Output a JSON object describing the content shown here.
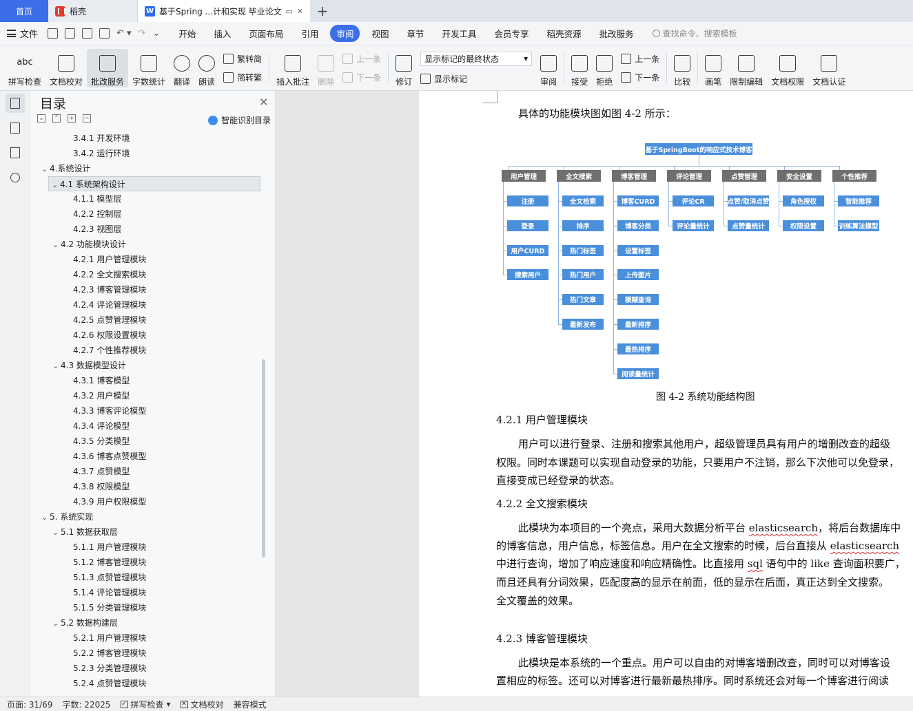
{
  "tabs": {
    "home": "首页",
    "daoke": "稻壳",
    "doc": "基于Spring ...计和实现 毕业论文",
    "add": "+"
  },
  "menu": {
    "file": "文件",
    "items": [
      "开始",
      "插入",
      "页面布局",
      "引用",
      "审阅",
      "视图",
      "章节",
      "开发工具",
      "会员专享",
      "稻壳资源",
      "批改服务"
    ],
    "active": "审阅",
    "search": "查找命令、搜索模板"
  },
  "ribbon": {
    "spell": "拼写检查",
    "spell_icon_text": "abc",
    "doccheck": "文档校对",
    "review_service": "批改服务",
    "wordcount": "字数统计",
    "translate": "翻译",
    "read": "朗读",
    "to_trad": "繁转简",
    "to_simp": "简转繁",
    "insert_comment": "插入批注",
    "delete": "删除",
    "prev": "上一条",
    "next": "下一条",
    "revise": "修订",
    "markup_state": "显示标记的最终状态",
    "show_markup": "显示标记",
    "review": "审阅",
    "accept": "接受",
    "reject": "拒绝",
    "prev2": "上一条",
    "next2": "下一条",
    "compare": "比较",
    "pen": "画笔",
    "restrict": "限制编辑",
    "doc_perm": "文档权限",
    "doc_cert": "文档认证"
  },
  "toc": {
    "title": "目录",
    "close": "×",
    "tools": [
      "⌄",
      "⌃",
      "+",
      "−"
    ],
    "smart": "智能识别目录",
    "items": [
      {
        "text": "3.4.1  开发环境",
        "level": 3
      },
      {
        "text": "3.4.2  运行环境",
        "level": 3
      },
      {
        "text": "4.系统设计",
        "level": 1,
        "caret": "⌄"
      },
      {
        "text": "4.1  系统架构设计",
        "level": 2,
        "caret": "⌄",
        "selected": true
      },
      {
        "text": "4.1.1 模型层",
        "level": 3
      },
      {
        "text": "4.2.2 控制层",
        "level": 3
      },
      {
        "text": "4.2.3 视图层",
        "level": 3
      },
      {
        "text": "4.2  功能模块设计",
        "level": 2,
        "caret": "⌄"
      },
      {
        "text": "4.2.1 用户管理模块",
        "level": 3
      },
      {
        "text": "4.2.2 全文搜索模块",
        "level": 3
      },
      {
        "text": "4.2.3 博客管理模块",
        "level": 3
      },
      {
        "text": "4.2.4 评论管理模块",
        "level": 3
      },
      {
        "text": "4.2.5 点赞管理模块",
        "level": 3
      },
      {
        "text": "4.2.6 权限设置模块",
        "level": 3
      },
      {
        "text": "4.2.7 个性推荐模块",
        "level": 3
      },
      {
        "text": "4.3  数据模型设计",
        "level": 2,
        "caret": "⌄"
      },
      {
        "text": "4.3.1 博客模型",
        "level": 3
      },
      {
        "text": "4.3.2 用户模型",
        "level": 3
      },
      {
        "text": "4.3.3 博客评论模型",
        "level": 3
      },
      {
        "text": "4.3.4 评论模型",
        "level": 3
      },
      {
        "text": "4.3.5 分类模型",
        "level": 3
      },
      {
        "text": "4.3.6 博客点赞模型",
        "level": 3
      },
      {
        "text": "4.3.7 点赞模型",
        "level": 3
      },
      {
        "text": "4.3.8 权限模型",
        "level": 3
      },
      {
        "text": "4.3.9 用户权限模型",
        "level": 3
      },
      {
        "text": "5.  系统实现",
        "level": 1,
        "caret": "⌄"
      },
      {
        "text": "5.1  数据获取层",
        "level": 2,
        "caret": "⌄"
      },
      {
        "text": "5.1.1  用户管理模块",
        "level": 3
      },
      {
        "text": "5.1.2  博客管理模块",
        "level": 3
      },
      {
        "text": "5.1.3  点赞管理模块",
        "level": 3
      },
      {
        "text": "5.1.4 评论管理模块",
        "level": 3
      },
      {
        "text": "5.1.5 分类管理模块",
        "level": 3
      },
      {
        "text": "5.2  数据构建层",
        "level": 2,
        "caret": "⌄"
      },
      {
        "text": "5.2.1  用户管理模块",
        "level": 3
      },
      {
        "text": "5.2.2  博客管理模块",
        "level": 3
      },
      {
        "text": "5.2.3  分类管理模块",
        "level": 3
      },
      {
        "text": "5.2.4  点赞管理模块",
        "level": 3
      }
    ]
  },
  "doc": {
    "intro": "具体的功能模块图如图 4-2 所示：",
    "diagram": {
      "root": "基于SpringBoot的响应式技术博客",
      "categories": [
        {
          "name": "用户管理",
          "children": [
            "注册",
            "登录",
            "用户CURD",
            "搜索用户"
          ]
        },
        {
          "name": "全文搜索",
          "children": [
            "全文检索",
            "排序",
            "热门标签",
            "热门用户",
            "热门文章",
            "最新发布"
          ]
        },
        {
          "name": "博客管理",
          "children": [
            "博客CURD",
            "博客分类",
            "设置标签",
            "上传图片",
            "模糊查询",
            "最新排序",
            "最热排序",
            "阅读量统计"
          ]
        },
        {
          "name": "评论管理",
          "children": [
            "评论CR",
            "评论量统计"
          ]
        },
        {
          "name": "点赞管理",
          "children": [
            "点赞/取消点赞",
            "点赞量统计"
          ]
        },
        {
          "name": "安全设置",
          "children": [
            "角色授权",
            "权限设置"
          ]
        },
        {
          "name": "个性推荐",
          "children": [
            "智能推荐",
            "训练算法模型"
          ]
        }
      ]
    },
    "caption": "图 4-2  系统功能结构图",
    "h421": "4.2.1 用户管理模块",
    "p421": [
      "用户可以进行登录、注册和搜索其他用户，超级管理员具有用户的增删改查的超级",
      "权限。同时本课题可以实现自动登录的功能，只要用户不注销，那么下次他可以免登录，",
      "直接变成已经登录的状态。"
    ],
    "h422": "4.2.2 全文搜索模块",
    "p422": {
      "l1a": "此模块为本项目的一个亮点，采用大数据分析平台 ",
      "l1b": "elasticsearch",
      "l1c": "，将后台数据库中",
      "l2a": "的博客信息，用户信息，标签信息。用户在全文搜索的时候，后台直接从 ",
      "l2b": "elasticsearch",
      "l3a": "中进行查询，增加了响应速度和响应精确性。比直接用 ",
      "l3b": "sql",
      "l3c": " 语句中的 like 查询面积要广，",
      "l4": "而且还具有分词效果，匹配度高的显示在前面，低的显示在后面，真正达到全文搜索。",
      "l5": "全文覆盖的效果。"
    },
    "h423": "4.2.3 博客管理模块",
    "p423": [
      "此模块是本系统的一个重点。用户可以自由的对博客增删改查，同时可以对博客设",
      "置相应的标签。还可以对博客进行最新最热排序。同时系统还会对每一个博客进行阅读"
    ]
  },
  "status": {
    "page": "页面: 31/69",
    "words": "字数: 22025",
    "spell": "拼写检查",
    "doccheck": "文档校对",
    "compat": "兼容模式"
  }
}
